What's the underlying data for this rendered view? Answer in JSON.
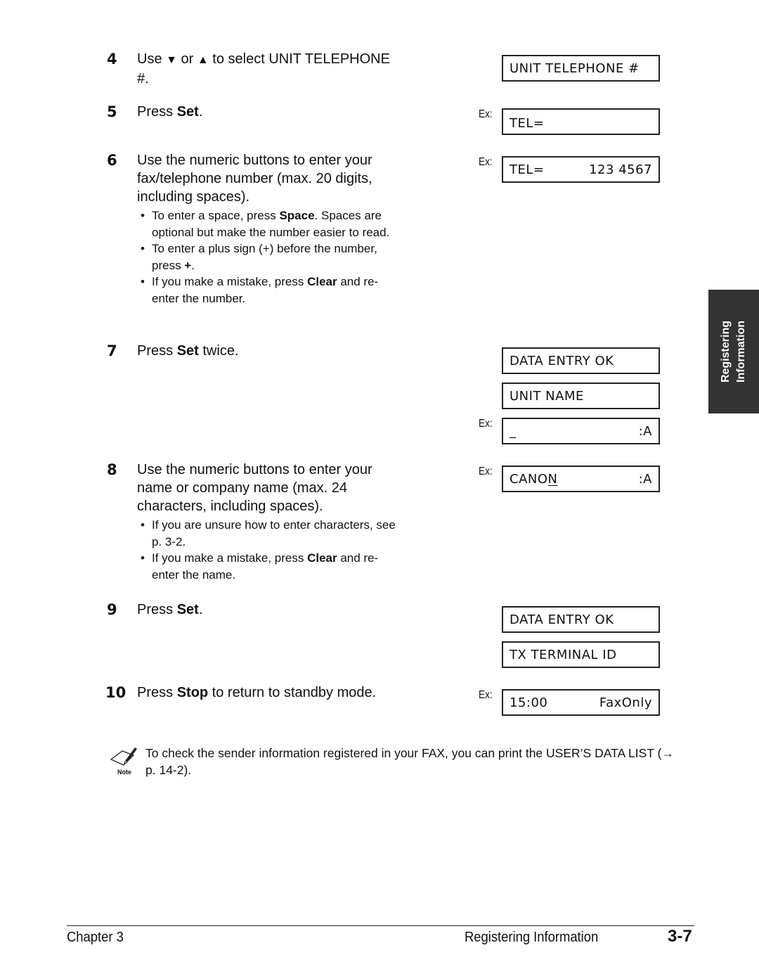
{
  "steps": [
    {
      "num": "4",
      "parts": [
        "Use ",
        "▼",
        " or ",
        "▲",
        " to select UNIT TELEPHONE #."
      ]
    },
    {
      "num": "5",
      "pre": "Press ",
      "bold": "Set",
      "post": "."
    },
    {
      "num": "6",
      "text": "Use the numeric buttons to enter your fax/telephone number (max. 20 digits, including spaces).",
      "bullets": [
        {
          "pre": "To enter a space, press ",
          "bold": "Space",
          "post": ". Spaces are optional but make the number easier to read."
        },
        {
          "pre": "To enter a plus sign (+) before the number, press ",
          "bold": "+",
          "post": "."
        },
        {
          "pre": "If you make a mistake, press ",
          "bold": "Clear",
          "post": " and re-enter the number."
        }
      ]
    },
    {
      "num": "7",
      "pre": "Press ",
      "bold": "Set",
      "post": " twice."
    },
    {
      "num": "8",
      "text": "Use the numeric buttons to enter your name or company name (max. 24 characters, including spaces).",
      "bullets": [
        {
          "pre": "If you are unsure how to enter characters, see p. 3-2.",
          "bold": "",
          "post": ""
        },
        {
          "pre": "If you make a mistake, press ",
          "bold": "Clear",
          "post": " and re-enter the name."
        }
      ]
    },
    {
      "num": "9",
      "pre": "Press ",
      "bold": "Set",
      "post": "."
    },
    {
      "num": "10",
      "pre": "Press ",
      "bold": "Stop",
      "post": " to return to standby mode."
    }
  ],
  "ex_label": "Ex:",
  "displays": [
    {
      "left": "UNIT TELEPHONE #",
      "right": "",
      "ex": false
    },
    {
      "left": "TEL=",
      "right": "",
      "ex": true
    },
    {
      "left": "TEL=",
      "right": "123 4567",
      "ex": true
    },
    {
      "left": "DATA ENTRY OK",
      "right": "",
      "ex": false
    },
    {
      "left": "UNIT NAME",
      "right": "",
      "ex": false
    },
    {
      "left": "_",
      "right": ":A",
      "ex": true
    },
    {
      "left_plain": "CANO",
      "left_underlined": "N",
      "right": ":A",
      "ex": true
    },
    {
      "left": "DATA ENTRY OK",
      "right": "",
      "ex": false
    },
    {
      "left": "TX TERMINAL ID",
      "right": "",
      "ex": false
    },
    {
      "left": "15:00",
      "right": "FaxOnly",
      "ex": true
    }
  ],
  "side_tab": {
    "line1": "Registering",
    "line2": "Information",
    "bg": "#333333"
  },
  "note": {
    "label": "Note",
    "text": "To check the sender information registered in your FAX, you can print the USER’S DATA LIST (→ p. 14-2)."
  },
  "footer": {
    "chapter": "Chapter 3",
    "section": "Registering Information",
    "page": "3-7"
  }
}
